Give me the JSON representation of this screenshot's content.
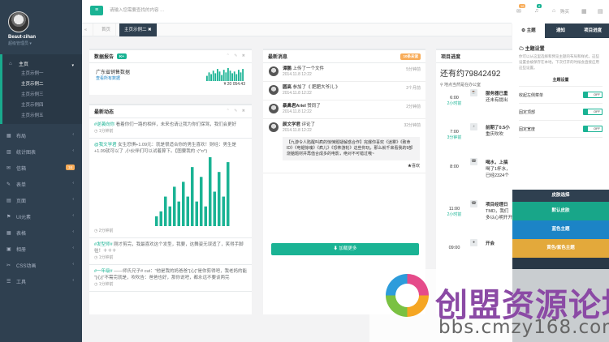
{
  "profile": {
    "name": "Beaut-zihan",
    "role": "超级管理员 ▾"
  },
  "nav": {
    "main_label": "主页",
    "main_sub": [
      "主页示例一",
      "主页示例二",
      "主页示例三",
      "主页示例四",
      "主页示例五"
    ],
    "items": [
      {
        "label": "布局",
        "icon": "▦"
      },
      {
        "label": "统计图表",
        "icon": "▥"
      },
      {
        "label": "信箱",
        "icon": "✉",
        "badge": "16"
      },
      {
        "label": "表单",
        "icon": "✎"
      },
      {
        "label": "页面",
        "icon": "▤"
      },
      {
        "label": "UI元素",
        "icon": "⚑"
      },
      {
        "label": "表格",
        "icon": "▦"
      },
      {
        "label": "相册",
        "icon": "▣"
      },
      {
        "label": "CSS动画",
        "icon": "✂"
      },
      {
        "label": "工具",
        "icon": "☰"
      }
    ]
  },
  "topbar": {
    "search_placeholder": "请输入您需要查找的内容 …",
    "badge_mail": "16",
    "badge_bell": "8",
    "buy_label": "购买"
  },
  "tabs": {
    "home": "首页",
    "current": "主页示例二 ✖"
  },
  "sales": {
    "title": "数据报告",
    "label": "K+",
    "name": "广东省销售数据",
    "sub": "查看所有数据",
    "amount": "¥ 20 054.43",
    "bars": [
      6,
      10,
      8,
      12,
      9,
      14,
      11,
      7,
      13,
      10,
      15,
      12,
      9,
      11,
      8,
      13,
      10,
      14
    ]
  },
  "feed": {
    "title": "最新动态",
    "items": [
      {
        "who": "#逆袭向你",
        "text": "看着你们一路的相伴，未来也请让我为你们保驾，我们会更好",
        "time": "1分钟前"
      },
      {
        "who": "@我文学君",
        "text": "女生恐惧+1.09元：就是很适合你的男生喜欢！财经：男生是+1.09就可以了 ,小伙伴们可以试着算下。【图要我的 :(^o^)",
        "time": "2分钟前"
      },
      {
        "who": "#发型师#",
        "text": "刚才剪完，我最喜欢这个发型，我要，这舞姿无误适了，笑得手脚往！＋＋＋",
        "time": "1分钟前"
      },
      {
        "who": "#一年级#",
        "text": "——师氏兄子# cut：\"他是我的妈爸爸\"[心]\"是你剪得吧，我老妈的能 \"[心]\"不需完就是，吹吹告：爸爸也好，那你说吧，都永远不要谈两完",
        "time": "1分钟前"
      }
    ],
    "chart": [
      2,
      3,
      6,
      4,
      8,
      5,
      9,
      6,
      12,
      5,
      10,
      4,
      14,
      7,
      11,
      6,
      13
    ]
  },
  "messages": {
    "title": "最新消息",
    "label": "10条未读",
    "items": [
      {
        "name": "谭鹏 ",
        "action": "上传了一个文件",
        "date": "2014.11.8 12:22",
        "ago": "5分钟前"
      },
      {
        "name": "圆高",
        "action": "参加了《 肥肥大爷儿 》",
        "date": "2014.11.8 12:22",
        "ago": "2个月前"
      },
      {
        "name": "暴鼻君Ariel",
        "action": "赞同了 ",
        "date": "2014.11.8 12:22",
        "ago": "2分钟前"
      },
      {
        "name": "颜文学君",
        "action": "评论了",
        "date": "2014.11.8 12:22",
        "ago": "32分钟前"
      }
    ],
    "quote": "【九游令人陷醒叫疯的惊悚题疑解惑合作】完爆你喜欢《迷雾》《致命ID》《电锯惊魂》《疯儿》《恐怖游轮》这些你玩，那么就千来看我的9部烧脑题材并再值合成多的电影，绝对不可错过哦~",
    "like": "★喜欢",
    "more": "⬇ 加载更多"
  },
  "progress": {
    "title": "项目进度",
    "number": "还有约79842492",
    "location": "⚲ 地点当然是在办公室",
    "rows": [
      {
        "time": "6:00",
        "ago": "2小时前",
        "icon": "☕",
        "text": "服务器已重\n还未有提出"
      },
      {
        "time": "7:00",
        "ago": "3分钟前",
        "icon": "♪",
        "text": "前期了0.5小\n重庆吹吹"
      },
      {
        "time": "8:00",
        "ago": "",
        "icon": "☎",
        "text": "喝水，上搞\n喝了1杯水，\n已经2324个"
      },
      {
        "time": "11:00",
        "ago": "2小时前",
        "icon": "☎",
        "text": "项目经理日\nTMD，我们\n多以心明开开"
      },
      {
        "time": "09:00",
        "ago": "",
        "icon": "●",
        "text": "开会"
      }
    ]
  },
  "right_sidebar": {
    "tabs": [
      "主题",
      "通知",
      "项目进度"
    ],
    "setting_title": "主题设置",
    "setting_desc": "你可以从这里选择和预览主题的布局和样式，这些设置会被保存在本地，下次打开的时候会直接应用这些设置。",
    "section": "主题设置",
    "options": [
      "收起左侧菜单",
      "固定顶部",
      "固定宽度"
    ],
    "switch_off": "OFF",
    "skin_head": "皮肤选择",
    "skins": [
      {
        "label": "默认皮肤",
        "color": "#18a689"
      },
      {
        "label": "蓝色主题",
        "color": "#1c84c6"
      },
      {
        "label": "黄色/紫色主题",
        "color": "#e3a93b"
      }
    ]
  },
  "watermark": {
    "text": "创盟资源论坛",
    "url": "bbs.cmzy168.com"
  }
}
